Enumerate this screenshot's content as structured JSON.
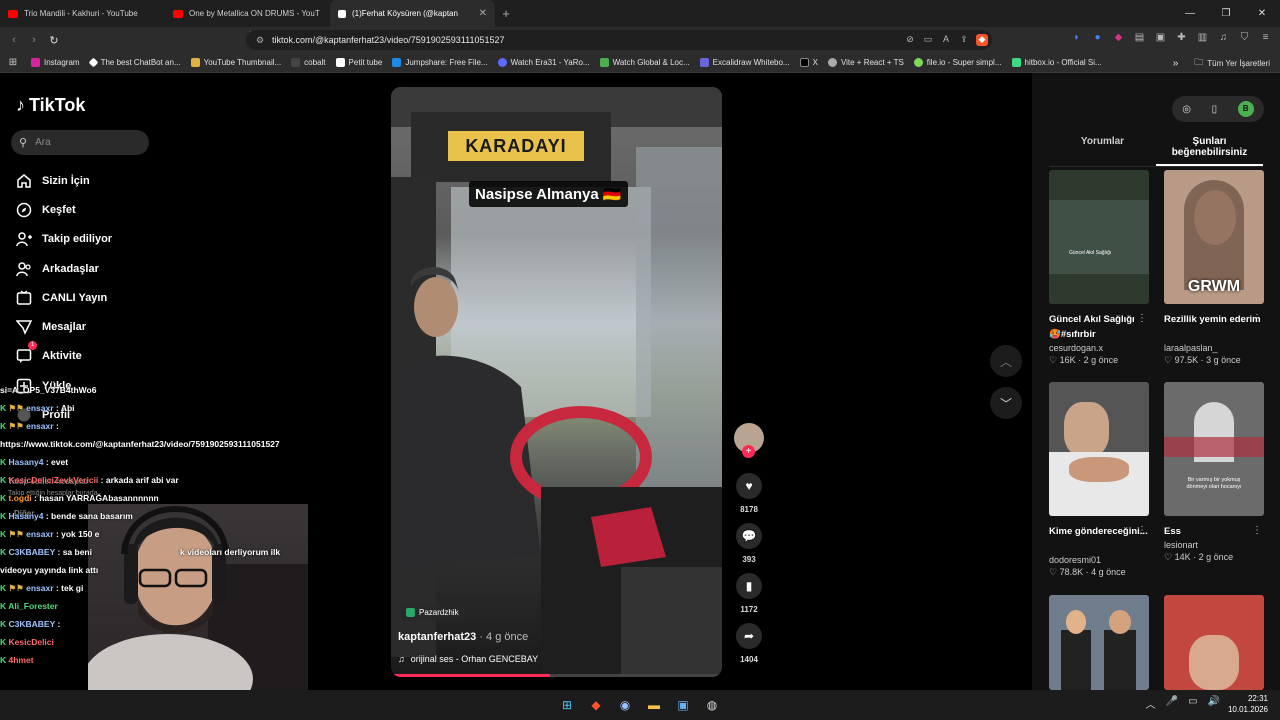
{
  "browser": {
    "tabs": [
      {
        "title": "Trio Mandili - Kakhuri - YouTube",
        "icon": "youtube-icon",
        "active": false
      },
      {
        "title": "One by Metallica ON DRUMS - YouT",
        "icon": "youtube-icon",
        "active": false
      },
      {
        "title": "(1)Ferhat Köysüren (@kaptan",
        "icon": "tiktok-icon",
        "active": true
      }
    ],
    "url": "tiktok.com/@kaptanferhat23/video/7591902593111051527",
    "bookmarks": [
      {
        "label": "Instagram",
        "color": "#d6249f"
      },
      {
        "label": "The best ChatBot an...",
        "color": "#ffffff"
      },
      {
        "label": "YouTube Thumbnail...",
        "color": "#e3b341"
      },
      {
        "label": "cobalt",
        "color": "#222222"
      },
      {
        "label": "Petit tube",
        "color": "#ffffff"
      },
      {
        "label": "Jumpshare: Free File...",
        "color": "#1e88e5"
      },
      {
        "label": "Watch Era31 - YaRo...",
        "color": "#5a6bff"
      },
      {
        "label": "Watch Global & Loc...",
        "color": "#4caf50"
      },
      {
        "label": "Excalidraw Whitebo...",
        "color": "#6965db"
      },
      {
        "label": "X",
        "color": "#000000"
      },
      {
        "label": "Vite + React + TS",
        "color": "#aaaaaa"
      },
      {
        "label": "file.io - Super simpl...",
        "color": "#7ed957"
      },
      {
        "label": "hitbox.io - Official Si...",
        "color": "#3ddc84"
      }
    ],
    "bookmarks_folder": "Tüm Yer İşaretleri"
  },
  "sidebar": {
    "logo": "TikTok",
    "search_placeholder": "Ara",
    "items": [
      {
        "label": "Sizin İçin",
        "icon": "home-icon"
      },
      {
        "label": "Keşfet",
        "icon": "compass-icon"
      },
      {
        "label": "Takip ediliyor",
        "icon": "following-icon"
      },
      {
        "label": "Arkadaşlar",
        "icon": "friends-icon"
      },
      {
        "label": "CANLI Yayın",
        "icon": "live-icon"
      },
      {
        "label": "Mesajlar",
        "icon": "messages-icon"
      },
      {
        "label": "Aktivite",
        "icon": "activity-icon"
      },
      {
        "label": "Yükle",
        "icon": "upload-icon"
      },
      {
        "label": "Profil",
        "icon": "profile-icon"
      }
    ],
    "activity_badge": "1",
    "followed_accounts_label": "Takip edilen hesaplar",
    "followed_accounts_hint": "Takip ettiğin hesaplar burada",
    "more_label": "Diğer"
  },
  "chat": [
    {
      "user": "",
      "msg": "si=A_OP5_V37B4thWo6",
      "color": "#ffffff"
    },
    {
      "user": "ensaxr",
      "msg": ": Abi",
      "color": "#9ec3ff"
    },
    {
      "user": "ensaxr",
      "msg": ":",
      "color": "#9ec3ff"
    },
    {
      "user": "",
      "msg": "https://www.tiktok.com/@kaptanferhat23/video/7591902593111051527",
      "color": "#ffffff"
    },
    {
      "user": "Hasany4",
      "msg": ": evet",
      "color": "#9ec3ff"
    },
    {
      "user": "KesicDeliciZevkVericii",
      "msg": ": arkada arif abi var",
      "color": "#ff6b6b"
    },
    {
      "user": "t.ogdi",
      "msg": ": hasan YARRAĞAbasannnnnn",
      "color": "#ff9a3c"
    },
    {
      "user": "Hasany4",
      "msg": ": bende sana basarım",
      "color": "#9ec3ff"
    },
    {
      "user": "ensaxr",
      "msg": ": yok 150 e",
      "color": "#9ec3ff"
    },
    {
      "user": "C3KBABEY",
      "msg": ": sa beni",
      "color": "#9ec3ff"
    },
    {
      "user": "",
      "msg": "k videoları derliyorum ilk",
      "color": "#ffffff"
    },
    {
      "user": "",
      "msg": "videoyu yayında link attı",
      "color": "#ffffff"
    },
    {
      "user": "ensaxr",
      "msg": ": tek gi",
      "color": "#9ec3ff"
    },
    {
      "user": "Ali_Forester",
      "msg": "",
      "color": "#4fdc78"
    },
    {
      "user": "C3KBABEY",
      "msg": ":",
      "color": "#9ec3ff"
    },
    {
      "user": "KesicDelici",
      "msg": "",
      "color": "#ff6b6b"
    },
    {
      "user": "4hmet",
      "msg": "",
      "color": "#ff6b6b"
    }
  ],
  "video": {
    "sign_text": "KARADAYI",
    "caption": "Nasipse Almanya 🇩🇪",
    "location": "Pazardzhik",
    "author": "kaptanferhat23",
    "time_ago": "· 4 g önce",
    "sound": "orijinal ses - Orhan GENCEBAY",
    "progress": 0.48,
    "likes": "8178",
    "comments": "393",
    "saves": "1172",
    "shares": "1404"
  },
  "right_panel": {
    "tabs": [
      "Yorumlar",
      "Şunları beğenebilirsiniz"
    ],
    "active_tab": 1,
    "user_initial": "B",
    "videos": [
      {
        "title": "Güncel Akıl Sağlığı 🥵#sıfırbir",
        "user": "cesurdogan.x",
        "likes": "16K",
        "ago": "2 g önce",
        "thumb_text": "Güncel Akıl Sağlığı",
        "thumb_color": "#2f3a2f"
      },
      {
        "title": "Rezillik yemin ederim",
        "user": "laraalpaslan_",
        "likes": "97.5K",
        "ago": "3 g önce",
        "thumb_text": "GRWM",
        "thumb_color": "#b89a86"
      },
      {
        "title": "Kime göndereceğini...",
        "user": "dodoresmi01",
        "likes": "78.8K",
        "ago": "4 g önce",
        "thumb_text": "",
        "thumb_color": "#555555"
      },
      {
        "title": "Ess",
        "user": "lesionart",
        "likes": "14K",
        "ago": "2 g önce",
        "thumb_text": "Bir varmış bir yokmuş dönmeyi olan hocanıyı",
        "thumb_color": "#6b6b6b"
      },
      {
        "title": "",
        "user": "",
        "likes": "",
        "ago": "",
        "thumb_text": "",
        "thumb_color": "#6f7d8c"
      },
      {
        "title": "",
        "user": "",
        "likes": "",
        "ago": "",
        "thumb_text": "",
        "thumb_color": "#c2473e"
      }
    ]
  },
  "taskbar": {
    "time": "22:31",
    "date": "10.01.2026"
  }
}
